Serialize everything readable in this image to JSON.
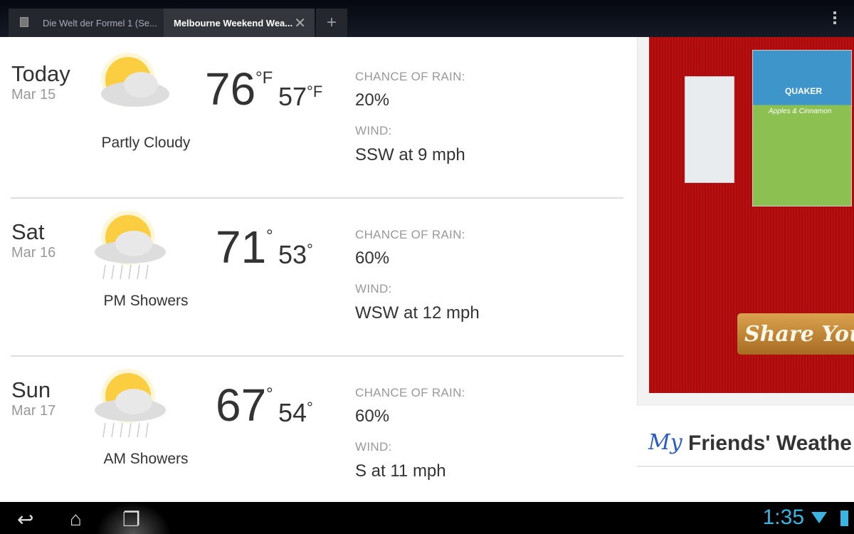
{
  "tabs": [
    {
      "label": "Die Welt der Formel 1 (Se..."
    },
    {
      "label": "Melbourne Weekend Wea...",
      "close": "✕"
    }
  ],
  "new_tab": "+",
  "forecast": [
    {
      "day": "Today",
      "date": "Mar 15",
      "condition": "Partly Cloudy",
      "icon": "partly-cloudy-icon",
      "high": "76",
      "high_unit": "°F",
      "low": "57",
      "low_unit": "°F",
      "rain_label": "CHANCE OF RAIN:",
      "rain": "20%",
      "wind_label": "WIND:",
      "wind": "SSW at 9 mph"
    },
    {
      "day": "Sat",
      "date": "Mar 16",
      "condition": "PM Showers",
      "icon": "showers-icon",
      "high": "71",
      "high_unit": "°",
      "low": "53",
      "low_unit": "°",
      "rain_label": "CHANCE OF RAIN:",
      "rain": "60%",
      "wind_label": "WIND:",
      "wind": "WSW at 12 mph"
    },
    {
      "day": "Sun",
      "date": "Mar 17",
      "condition": "AM Showers",
      "icon": "showers-icon",
      "high": "67",
      "high_unit": "°",
      "low": "54",
      "low_unit": "°",
      "rain_label": "CHANCE OF RAIN:",
      "rain": "60%",
      "wind_label": "WIND:",
      "wind": "S at 11 mph"
    }
  ],
  "ad": {
    "brand": "QUAKER",
    "product": "Apples & Cinnamon",
    "button": "Share You"
  },
  "friends": {
    "my": "My",
    "title": "Friends' Weathe"
  },
  "status": {
    "time": "1:35"
  },
  "colors": {
    "ad_red": "#b80f10",
    "accent": "#3ab4e0"
  }
}
